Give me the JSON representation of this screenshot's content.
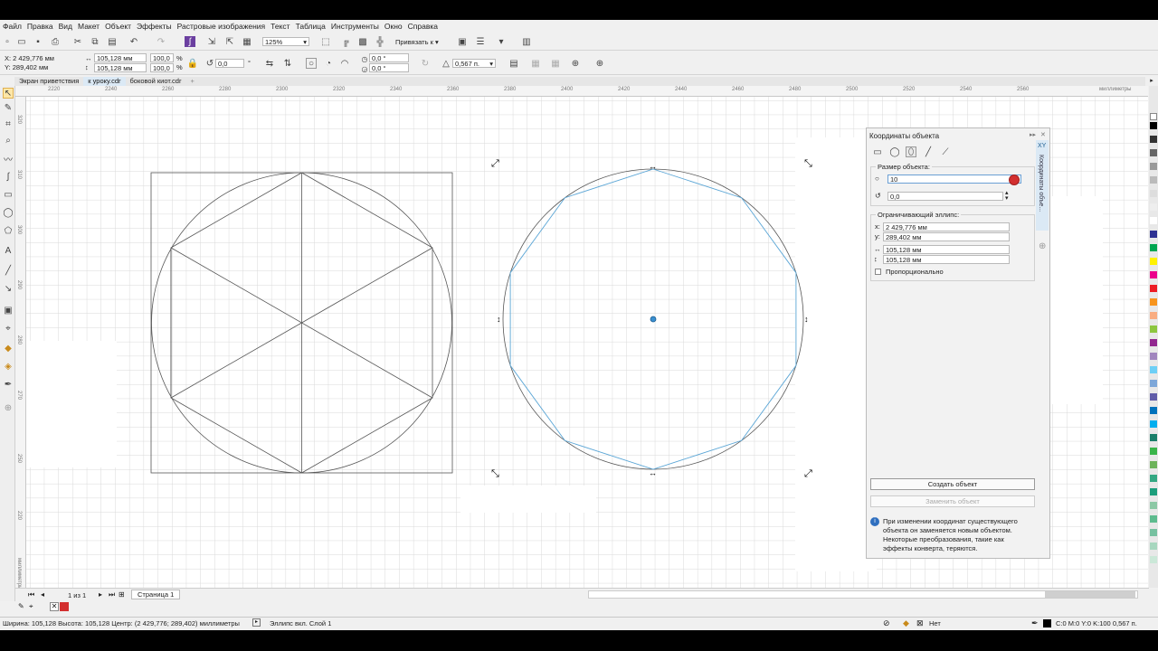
{
  "menu": [
    "Файл",
    "Правка",
    "Вид",
    "Макет",
    "Объект",
    "Эффекты",
    "Растровые изображения",
    "Текст",
    "Таблица",
    "Инструменты",
    "Окно",
    "Справка"
  ],
  "toolbar1": {
    "zoom": "125%",
    "snap_label": "Привязать к"
  },
  "propbar": {
    "x": "X: 2 429,776 мм",
    "y": "Y: 289,402 мм",
    "width": "105,128 мм",
    "height": "105,128 мм",
    "scale_x": "100,0",
    "scale_y": "100,0",
    "pct": "%",
    "rotation": "0,0",
    "degree": "°",
    "angle1": "0,0 °",
    "angle2": "0,0 °",
    "outline": "0,567 п."
  },
  "tabs": [
    "Экран приветствия",
    "к уроку.cdr",
    "боковой киот.cdr"
  ],
  "tabs_add": "+",
  "ruler_h": [
    "2220",
    "2240",
    "2260",
    "2280",
    "2300",
    "2320",
    "2340",
    "2360",
    "2380",
    "2400",
    "2420",
    "2440",
    "2460",
    "2480",
    "2500",
    "2520",
    "2540",
    "2560"
  ],
  "ruler_h_unit": "миллиметры",
  "ruler_v": [
    "320",
    "310",
    "300",
    "290",
    "280",
    "270",
    "260",
    "250",
    "240",
    "230",
    "220"
  ],
  "ruler_v_unit": "миллиметры",
  "docker": {
    "title": "Координаты объекта",
    "size_section": "Размер объекта:",
    "size_value": "10",
    "rotation_value": "0,0",
    "bbox_section": "Ограничивающий эллипс:",
    "x_label": "x:",
    "x_value": "2 429,776 мм",
    "y_label": "y:",
    "y_value": "289,402 мм",
    "w_value": "105,128 мм",
    "h_value": "105,128 мм",
    "proportional": "Пропорционально",
    "create_button": "Создать объект",
    "replace_button": "Заменить объект",
    "info": "При изменении координат существующего объекта он заменяется новым объектом. Некоторые преобразования, такие как эффекты конверта, теряются.",
    "xy_tab": "XY",
    "side_tab": "Координаты объе..."
  },
  "nav": {
    "page_count": "1 из 1",
    "page_tab": "Страница 1"
  },
  "status": {
    "left": "Ширина: 105,128  Высота: 105,128  Центр: (2 429,776; 289,402)  миллиметры",
    "object": "Эллипс вкл. Слой 1",
    "fill_none": "Нет",
    "outline_info": "C:0 M:0 Y:0 K:100  0,567 п."
  },
  "colors": {
    "accent": "#3a8fd0",
    "polygon": "#5ba6d6",
    "red_marker": "#d32f2f"
  },
  "icons": [
    "new-icon",
    "open-icon",
    "save-icon",
    "print-icon",
    "cut-icon",
    "copy-icon",
    "paste-icon",
    "undo-icon",
    "redo-icon",
    "import-icon",
    "export-icon",
    "pointer-icon",
    "shape-icon",
    "crop-icon",
    "zoom-icon",
    "curve-icon",
    "rectangle-icon",
    "ellipse-icon",
    "polygon-icon",
    "text-icon",
    "info-icon"
  ]
}
